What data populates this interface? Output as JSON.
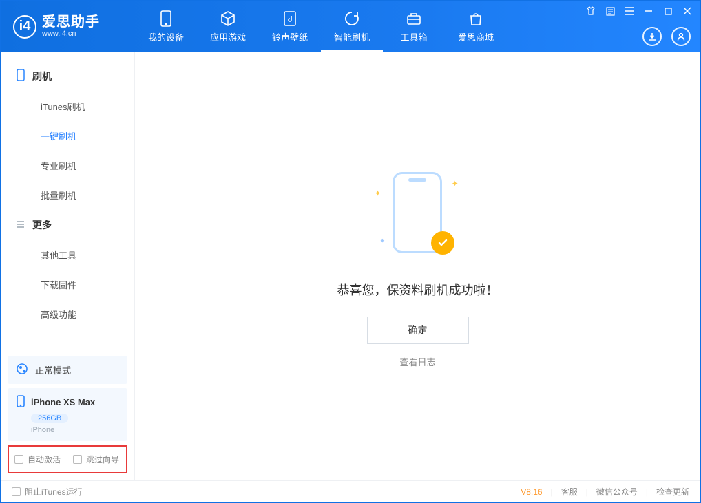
{
  "app": {
    "title": "爱思助手",
    "subtitle": "www.i4.cn"
  },
  "tabs": [
    {
      "id": "device",
      "label": "我的设备"
    },
    {
      "id": "apps",
      "label": "应用游戏"
    },
    {
      "id": "ringtone",
      "label": "铃声壁纸"
    },
    {
      "id": "flash",
      "label": "智能刷机",
      "active": true
    },
    {
      "id": "toolbox",
      "label": "工具箱"
    },
    {
      "id": "store",
      "label": "爱思商城"
    }
  ],
  "sidebar": {
    "sections": [
      {
        "title": "刷机",
        "icon": "phone",
        "items": [
          {
            "label": "iTunes刷机"
          },
          {
            "label": "一键刷机",
            "active": true
          },
          {
            "label": "专业刷机"
          },
          {
            "label": "批量刷机"
          }
        ]
      },
      {
        "title": "更多",
        "icon": "list",
        "items": [
          {
            "label": "其他工具"
          },
          {
            "label": "下载固件"
          },
          {
            "label": "高级功能"
          }
        ]
      }
    ],
    "mode_label": "正常模式",
    "device": {
      "name": "iPhone XS Max",
      "capacity": "256GB",
      "type": "iPhone"
    },
    "checkboxes": {
      "auto_activate": "自动激活",
      "skip_wizard": "跳过向导"
    }
  },
  "main": {
    "success_text": "恭喜您，保资料刷机成功啦！",
    "ok_button": "确定",
    "view_log": "查看日志"
  },
  "footer": {
    "block_itunes": "阻止iTunes运行",
    "version": "V8.16",
    "links": {
      "support": "客服",
      "wechat": "微信公众号",
      "update": "检查更新"
    }
  }
}
